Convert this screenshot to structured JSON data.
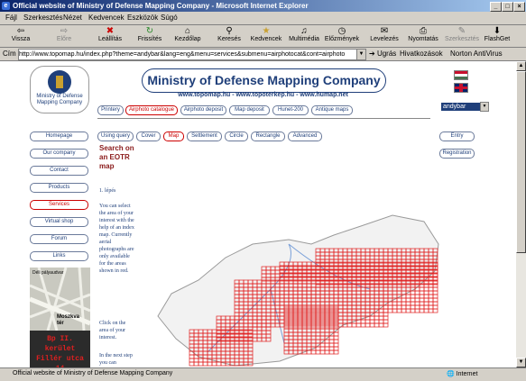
{
  "window": {
    "title": "Official website of Ministry of Defense Mapping Company - Microsoft Internet Explorer"
  },
  "menu": [
    "Fájl",
    "Szerkesztés",
    "Nézet",
    "Kedvencek",
    "Eszközök",
    "Súgó"
  ],
  "toolbar": [
    "Vissza",
    "Előre",
    "Leállítás",
    "Frissítés",
    "Kezdőlap",
    "Keresés",
    "Kedvencek",
    "Multimédia",
    "Előzmények",
    "Levelezés",
    "Nyomtatás",
    "Szerkesztés",
    "FlashGet"
  ],
  "address": {
    "label": "Cím",
    "url": "http://www.topomap.hu/index.php?theme=andybar&lang=eng&menu=services&submenu=airphotocat&cont=airphoto",
    "go": "Ugrás",
    "links": "Hivatkozások",
    "antivirus": "Norton AntiVirus"
  },
  "site": {
    "logo_text": "Ministry of Defense Mapping Company",
    "banner": "Ministry of Defense Mapping Company",
    "sublinks": "www.topomap.hu - www.topoterkep.hu - www.humap.net",
    "lang_select": "andybar",
    "tabs": [
      "Printery",
      "Airphoto catalogue",
      "Airphoto deposit",
      "Map deposit",
      "Hunet-200",
      "Antique maps"
    ],
    "subtabs": [
      "Using query",
      "Cover",
      "Map",
      "Settlement",
      "Circle",
      "Rectangle",
      "Advanced"
    ],
    "nav": [
      "Homepage",
      "Our company",
      "Contact",
      "Products",
      "Services",
      "Virtual shop",
      "Forum",
      "Links"
    ],
    "right_nav": [
      "Entry",
      "Registration"
    ],
    "heading": "Search on an EOTR map",
    "step": "1. lépés",
    "para1": "You can select the area of your interest with the help of an index map. Currently aerial photographs are only available for the areas shown in red.",
    "para2": "Click on the area of your interest.",
    "para3": "In the next step you can",
    "thumb_labels": [
      "Moszkva tér",
      "Déli pályaudvar"
    ],
    "address_lines": [
      "Bp II. kerület",
      "Fillér utca 14"
    ]
  },
  "status": {
    "text": "Official website of Ministry of Defense Mapping Company",
    "zone": "Internet"
  },
  "colors": {
    "accent": "#1f3f7a",
    "active": "#cc0000",
    "map_red": "#e02020"
  }
}
